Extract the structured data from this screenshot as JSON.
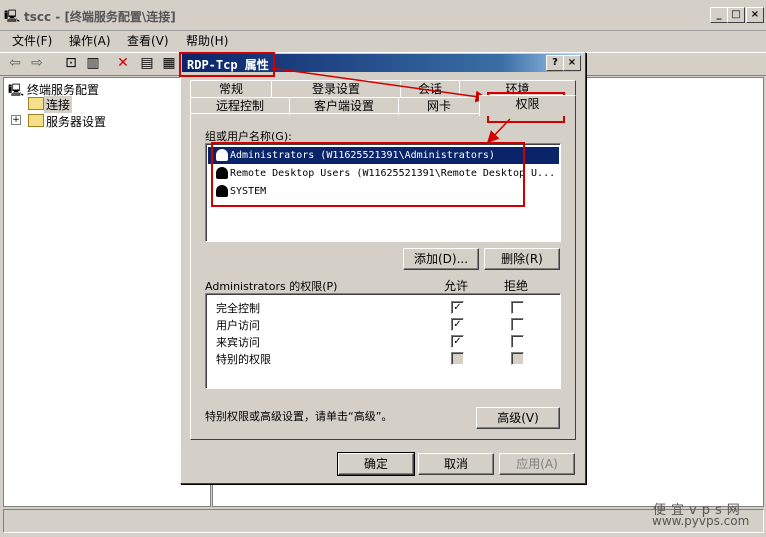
{
  "window": {
    "title": "tscc - [终端服务配置\\连接]",
    "controls": {
      "minimize": "_",
      "maximize": "□",
      "close": "×"
    }
  },
  "menu": [
    "文件(F)",
    "操作(A)",
    "查看(V)",
    "帮助(H)"
  ],
  "tree": {
    "root": "终端服务配置",
    "child1": "连接",
    "child2": "服务器设置"
  },
  "dialog": {
    "title": "RDP-Tcp 属性",
    "help": "?",
    "close": "×",
    "tabs_row1": [
      "常规",
      "登录设置",
      "会话",
      "环境"
    ],
    "tabs_row2": [
      "远程控制",
      "客户端设置",
      "网卡",
      "权限"
    ],
    "group_label": "组或用户名称(G):",
    "users": [
      "Administrators (W11625521391\\Administrators)",
      "Remote Desktop Users (W11625521391\\Remote Desktop U...",
      "SYSTEM"
    ],
    "add_button": "添加(D)...",
    "remove_button": "删除(R)",
    "perm_label": "Administrators 的权限(P)",
    "allow_header": "允许",
    "deny_header": "拒绝",
    "permissions": [
      {
        "name": "完全控制",
        "allow": "✓",
        "deny": ""
      },
      {
        "name": "用户访问",
        "allow": "✓",
        "deny": ""
      },
      {
        "name": "来宾访问",
        "allow": "✓",
        "deny": ""
      },
      {
        "name": "特别的权限",
        "allow": "",
        "deny": ""
      }
    ],
    "advanced_text": "特别权限或高级设置，请单击“高级”。",
    "advanced_button": "高级(V)",
    "ok_button": "确定",
    "cancel_button": "取消",
    "apply_button": "应用(A)"
  },
  "watermark": {
    "line1": "便宜vps网",
    "line2": "www.pyvps.com"
  },
  "colors": {
    "highlight": "#d00000",
    "title_active": "#0a246a",
    "selection": "#0a246a"
  }
}
